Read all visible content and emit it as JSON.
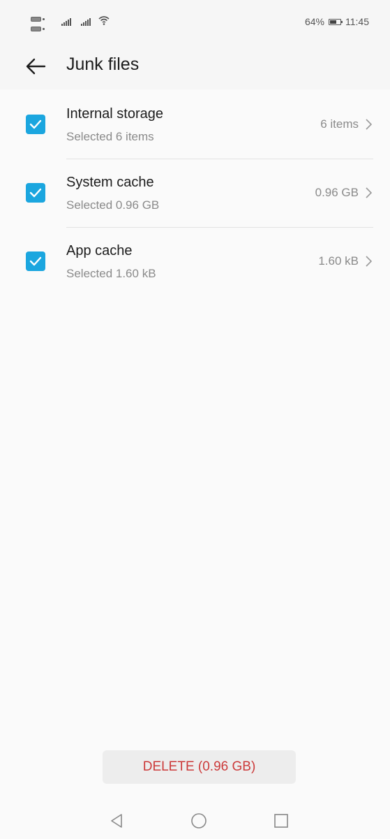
{
  "status_bar": {
    "battery_percent": "64%",
    "battery_level": 0.64,
    "time": "11:45",
    "icons": [
      "sim-card-icon",
      "signal-icon",
      "wifi-icon",
      "battery-icon"
    ]
  },
  "header": {
    "title": "Junk files",
    "back_icon": "back-arrow-icon"
  },
  "items": [
    {
      "title": "Internal storage",
      "subtitle": "Selected 6 items",
      "value": "6 items",
      "checked": true
    },
    {
      "title": "System cache",
      "subtitle": "Selected 0.96 GB",
      "value": "0.96 GB",
      "checked": true
    },
    {
      "title": "App cache",
      "subtitle": "Selected 1.60 kB",
      "value": "1.60 kB",
      "checked": true
    }
  ],
  "delete_button": {
    "label": "DELETE (0.96 GB)"
  },
  "navigation": {
    "icons": [
      "nav-back-icon",
      "nav-home-icon",
      "nav-recents-icon"
    ]
  },
  "colors": {
    "accent": "#1ba6df",
    "delete_text": "#cc3a3a",
    "background": "#fafafa"
  }
}
